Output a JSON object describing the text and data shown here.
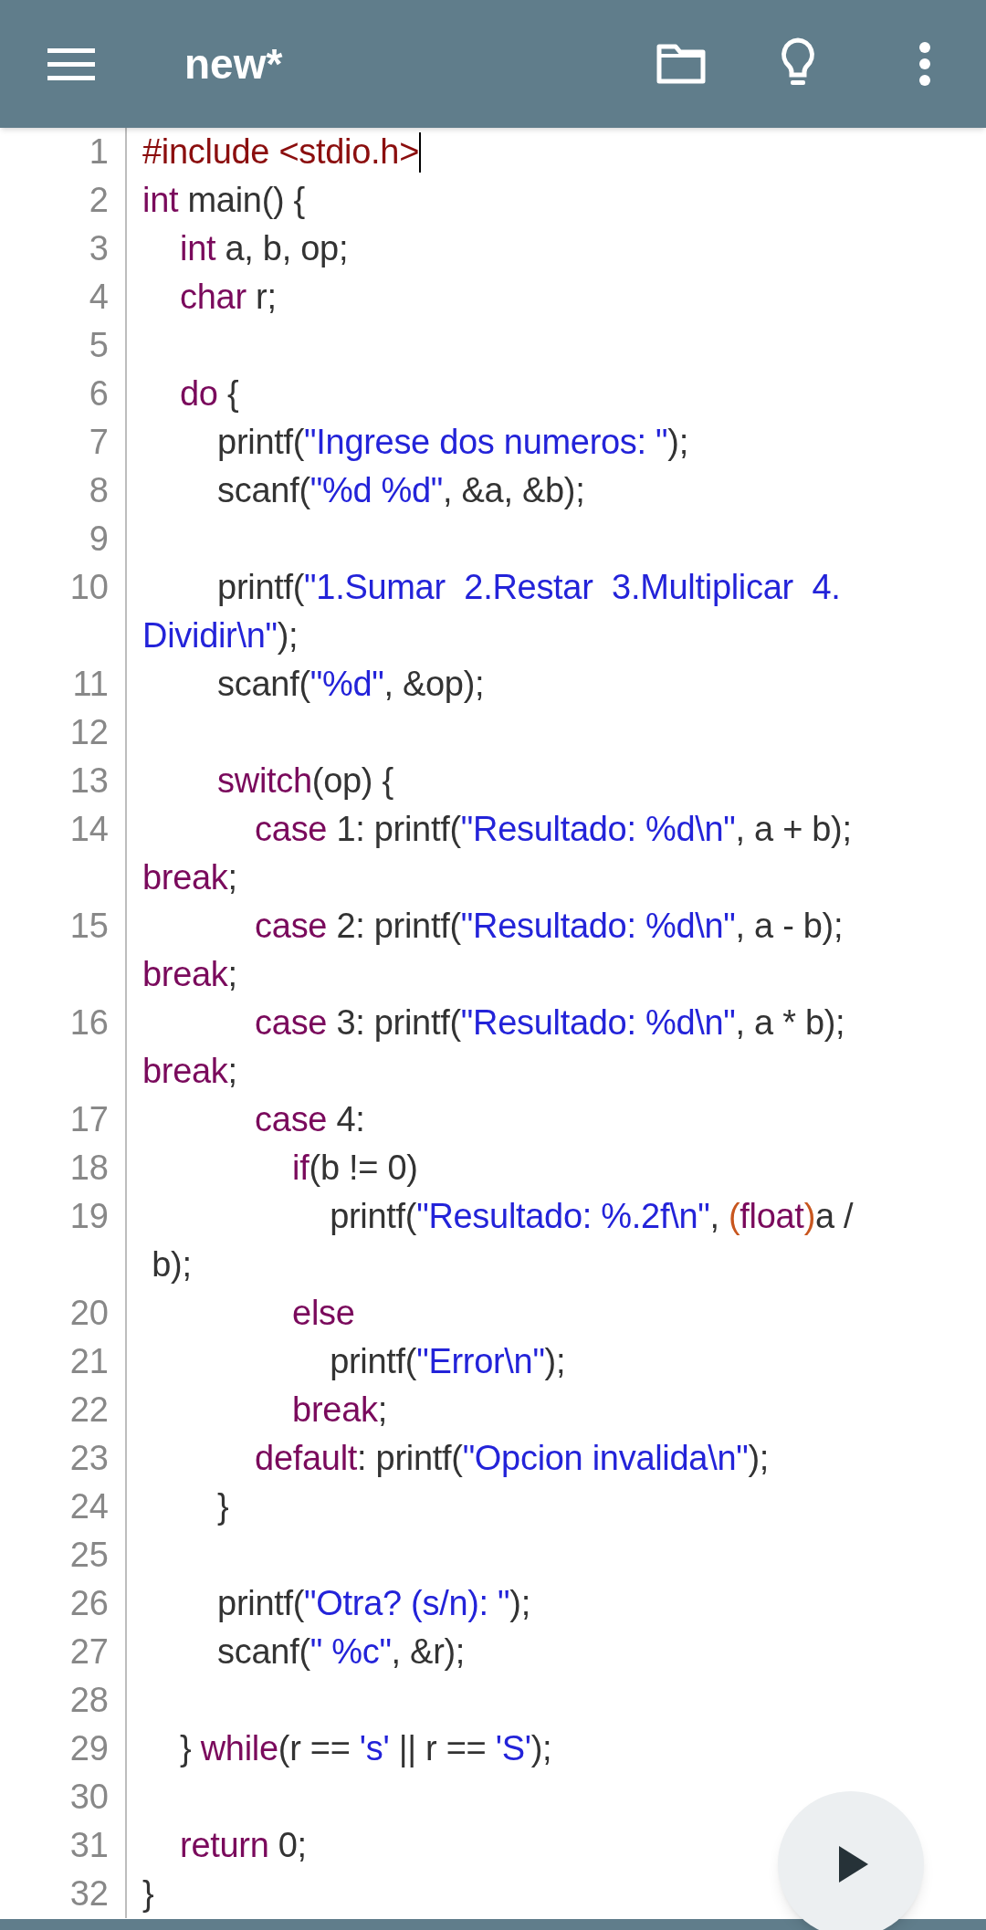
{
  "app_bar": {
    "title": "new*"
  },
  "lines": [
    {
      "number": "1",
      "cursor": true,
      "wraps": [
        {
          "tokens": [
            {
              "kind": "preprocessor",
              "text": "#include <stdio.h>"
            }
          ]
        }
      ]
    },
    {
      "number": "2",
      "cursor": false,
      "wraps": [
        {
          "tokens": [
            {
              "kind": "keyword",
              "text": "int"
            },
            {
              "kind": "plain",
              "text": " main() {"
            }
          ]
        }
      ]
    },
    {
      "number": "3",
      "cursor": false,
      "wraps": [
        {
          "tokens": [
            {
              "kind": "keyword",
              "text": "    int"
            },
            {
              "kind": "plain",
              "text": " a, b, op;"
            }
          ]
        }
      ]
    },
    {
      "number": "4",
      "cursor": false,
      "wraps": [
        {
          "tokens": [
            {
              "kind": "keyword",
              "text": "    char"
            },
            {
              "kind": "plain",
              "text": " r;"
            }
          ]
        }
      ]
    },
    {
      "number": "5",
      "cursor": false
    },
    {
      "number": "6",
      "cursor": false,
      "wraps": [
        {
          "tokens": [
            {
              "kind": "keyword",
              "text": "    do"
            },
            {
              "kind": "plain",
              "text": " {"
            }
          ]
        }
      ]
    },
    {
      "number": "7",
      "cursor": false,
      "wraps": [
        {
          "tokens": [
            {
              "kind": "plain",
              "text": "        printf("
            },
            {
              "kind": "string",
              "text": "\"Ingrese dos numeros: \""
            },
            {
              "kind": "plain",
              "text": ");"
            }
          ]
        }
      ]
    },
    {
      "number": "8",
      "cursor": false,
      "wraps": [
        {
          "tokens": [
            {
              "kind": "plain",
              "text": "        scanf("
            },
            {
              "kind": "string",
              "text": "\"%d %d\""
            },
            {
              "kind": "plain",
              "text": ", &a, &b);"
            }
          ]
        }
      ]
    },
    {
      "number": "9",
      "cursor": false
    },
    {
      "number": "10",
      "cursor": false,
      "wraps": [
        {
          "tokens": [
            {
              "kind": "plain",
              "text": "        printf("
            },
            {
              "kind": "string",
              "text": "\"1.Sumar  2.Restar  3.Multiplicar  4."
            }
          ]
        },
        {
          "tokens": [
            {
              "kind": "string",
              "text": "Dividir\\n\""
            },
            {
              "kind": "plain",
              "text": ");"
            }
          ]
        }
      ]
    },
    {
      "number": "11",
      "cursor": false,
      "wraps": [
        {
          "tokens": [
            {
              "kind": "plain",
              "text": "        scanf("
            },
            {
              "kind": "string",
              "text": "\"%d\""
            },
            {
              "kind": "plain",
              "text": ", &op);"
            }
          ]
        }
      ]
    },
    {
      "number": "12",
      "cursor": false
    },
    {
      "number": "13",
      "cursor": false,
      "wraps": [
        {
          "tokens": [
            {
              "kind": "keyword",
              "text": "        switch"
            },
            {
              "kind": "plain",
              "text": "(op) {"
            }
          ]
        }
      ]
    },
    {
      "number": "14",
      "cursor": false,
      "wraps": [
        {
          "tokens": [
            {
              "kind": "keyword",
              "text": "            case"
            },
            {
              "kind": "plain",
              "text": " 1: printf("
            },
            {
              "kind": "string",
              "text": "\"Resultado: %d\\n\""
            },
            {
              "kind": "plain",
              "text": ", a + b);"
            }
          ]
        },
        {
          "tokens": [
            {
              "kind": "keyword",
              "text": "break"
            },
            {
              "kind": "plain",
              "text": ";"
            }
          ]
        }
      ]
    },
    {
      "number": "15",
      "cursor": false,
      "wraps": [
        {
          "tokens": [
            {
              "kind": "keyword",
              "text": "            case"
            },
            {
              "kind": "plain",
              "text": " 2: printf("
            },
            {
              "kind": "string",
              "text": "\"Resultado: %d\\n\""
            },
            {
              "kind": "plain",
              "text": ", a - b);"
            }
          ]
        },
        {
          "tokens": [
            {
              "kind": "keyword",
              "text": "break"
            },
            {
              "kind": "plain",
              "text": ";"
            }
          ]
        }
      ]
    },
    {
      "number": "16",
      "cursor": false,
      "wraps": [
        {
          "tokens": [
            {
              "kind": "keyword",
              "text": "            case"
            },
            {
              "kind": "plain",
              "text": " 3: printf("
            },
            {
              "kind": "string",
              "text": "\"Resultado: %d\\n\""
            },
            {
              "kind": "plain",
              "text": ", a * b);"
            }
          ]
        },
        {
          "tokens": [
            {
              "kind": "keyword",
              "text": "break"
            },
            {
              "kind": "plain",
              "text": ";"
            }
          ]
        }
      ]
    },
    {
      "number": "17",
      "cursor": false,
      "wraps": [
        {
          "tokens": [
            {
              "kind": "keyword",
              "text": "            case"
            },
            {
              "kind": "plain",
              "text": " 4:"
            }
          ]
        }
      ]
    },
    {
      "number": "18",
      "cursor": false,
      "wraps": [
        {
          "tokens": [
            {
              "kind": "keyword",
              "text": "                if"
            },
            {
              "kind": "plain",
              "text": "(b != 0)"
            }
          ]
        }
      ]
    },
    {
      "number": "19",
      "cursor": false,
      "wraps": [
        {
          "tokens": [
            {
              "kind": "plain",
              "text": "                    printf("
            },
            {
              "kind": "string",
              "text": "\"Resultado: %.2f\\n\""
            },
            {
              "kind": "plain",
              "text": ", "
            },
            {
              "kind": "paren",
              "text": "("
            },
            {
              "kind": "keyword",
              "text": "float"
            },
            {
              "kind": "paren",
              "text": ")"
            },
            {
              "kind": "plain",
              "text": "a /"
            }
          ]
        },
        {
          "tokens": [
            {
              "kind": "plain",
              "text": " b);"
            }
          ]
        }
      ]
    },
    {
      "number": "20",
      "cursor": false,
      "wraps": [
        {
          "tokens": [
            {
              "kind": "keyword",
              "text": "                else"
            }
          ]
        }
      ]
    },
    {
      "number": "21",
      "cursor": false,
      "wraps": [
        {
          "tokens": [
            {
              "kind": "plain",
              "text": "                    printf("
            },
            {
              "kind": "string",
              "text": "\"Error\\n\""
            },
            {
              "kind": "plain",
              "text": ");"
            }
          ]
        }
      ]
    },
    {
      "number": "22",
      "cursor": false,
      "wraps": [
        {
          "tokens": [
            {
              "kind": "keyword",
              "text": "                break"
            },
            {
              "kind": "plain",
              "text": ";"
            }
          ]
        }
      ]
    },
    {
      "number": "23",
      "cursor": false,
      "wraps": [
        {
          "tokens": [
            {
              "kind": "keyword",
              "text": "            default"
            },
            {
              "kind": "plain",
              "text": ": printf("
            },
            {
              "kind": "string",
              "text": "\"Opcion invalida\\n\""
            },
            {
              "kind": "plain",
              "text": ");"
            }
          ]
        }
      ]
    },
    {
      "number": "24",
      "cursor": false,
      "wraps": [
        {
          "tokens": [
            {
              "kind": "plain",
              "text": "        }"
            }
          ]
        }
      ]
    },
    {
      "number": "25",
      "cursor": false
    },
    {
      "number": "26",
      "cursor": false,
      "wraps": [
        {
          "tokens": [
            {
              "kind": "plain",
              "text": "        printf("
            },
            {
              "kind": "string",
              "text": "\"Otra? (s/n): \""
            },
            {
              "kind": "plain",
              "text": ");"
            }
          ]
        }
      ]
    },
    {
      "number": "27",
      "cursor": false,
      "wraps": [
        {
          "tokens": [
            {
              "kind": "plain",
              "text": "        scanf("
            },
            {
              "kind": "string",
              "text": "\" %c\""
            },
            {
              "kind": "plain",
              "text": ", &r);"
            }
          ]
        }
      ]
    },
    {
      "number": "28",
      "cursor": false
    },
    {
      "number": "29",
      "cursor": false,
      "wraps": [
        {
          "tokens": [
            {
              "kind": "plain",
              "text": "    } "
            },
            {
              "kind": "keyword",
              "text": "while"
            },
            {
              "kind": "plain",
              "text": "(r == "
            },
            {
              "kind": "string",
              "text": "'s'"
            },
            {
              "kind": "plain",
              "text": " || r == "
            },
            {
              "kind": "string",
              "text": "'S'"
            },
            {
              "kind": "plain",
              "text": ");"
            }
          ]
        }
      ]
    },
    {
      "number": "30",
      "cursor": false
    },
    {
      "number": "31",
      "cursor": false,
      "wraps": [
        {
          "tokens": [
            {
              "kind": "keyword",
              "text": "    return"
            },
            {
              "kind": "plain",
              "text": " 0;"
            }
          ]
        }
      ]
    },
    {
      "number": "32",
      "cursor": false,
      "wraps": [
        {
          "tokens": [
            {
              "kind": "plain",
              "text": "}"
            }
          ]
        }
      ]
    }
  ]
}
